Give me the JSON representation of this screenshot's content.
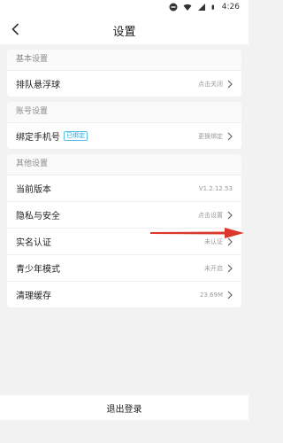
{
  "status_bar": {
    "time": "4:26",
    "icons": [
      "dnd-icon",
      "wifi-icon",
      "signal-icon",
      "battery-icon"
    ]
  },
  "header": {
    "title": "设置",
    "back_icon": "chevron-left-icon"
  },
  "sections": {
    "basic": {
      "title": "基本设置",
      "floating_queue": {
        "label": "排队悬浮球",
        "value": "点击关闭"
      }
    },
    "account": {
      "title": "账号设置",
      "bind_phone": {
        "label": "绑定手机号",
        "tag": "已绑定",
        "value": "更换绑定"
      }
    },
    "other": {
      "title": "其他设置",
      "version": {
        "label": "当前版本",
        "value": "V1.2.12.53"
      },
      "privacy": {
        "label": "隐私与安全",
        "value": "点击设置"
      },
      "real_name": {
        "label": "实名认证",
        "value": "未认证"
      },
      "teen_mode": {
        "label": "青少年模式",
        "value": "未开启"
      },
      "clear_cache": {
        "label": "清理缓存",
        "value": "23.69M"
      }
    }
  },
  "logout": {
    "label": "退出登录"
  },
  "colors": {
    "accent_tag": "#2aa7e0",
    "annotation_arrow": "#d9382a",
    "background": "#f2f2f2"
  }
}
